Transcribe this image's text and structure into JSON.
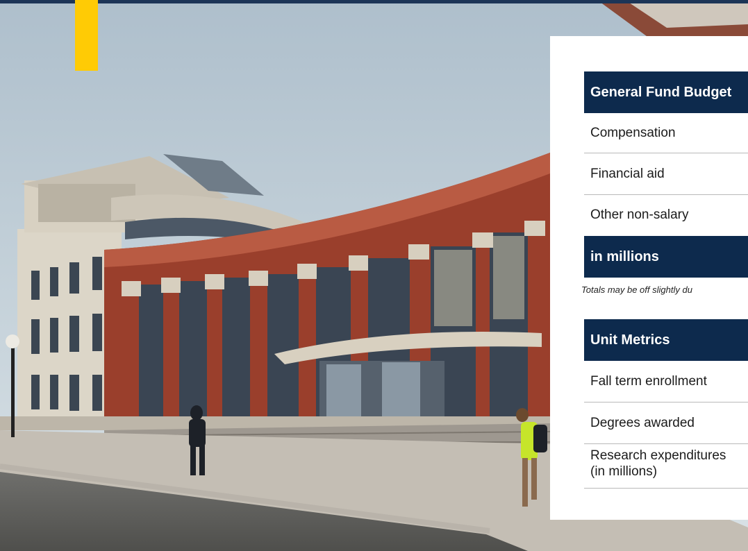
{
  "budget": {
    "header": "General Fund Budget",
    "rows": [
      "Compensation",
      "Financial aid",
      "Other non-salary"
    ],
    "subheader": "in millions",
    "note": "Totals may be off slightly du"
  },
  "metrics": {
    "header": "Unit Metrics",
    "rows": [
      "Fall term enrollment",
      "Degrees awarded"
    ],
    "research_line1": "Research expenditures",
    "research_line2": "(in millions)"
  },
  "colors": {
    "navy": "#0d2a4d",
    "maize": "#ffcb05",
    "brick": "#9a3f2c"
  }
}
